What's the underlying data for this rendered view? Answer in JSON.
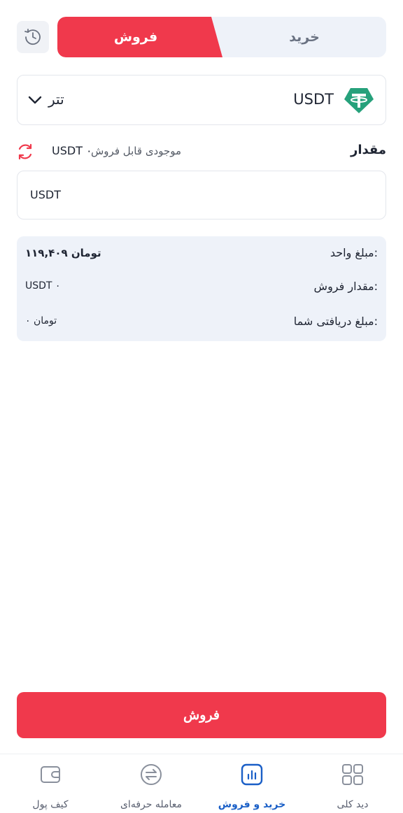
{
  "header": {
    "tabs": [
      {
        "label": "فروش",
        "active": true
      },
      {
        "label": "خرید",
        "active": false
      }
    ],
    "history_icon": "clock-history-icon"
  },
  "currency": {
    "code": "USDT",
    "name": "تتر",
    "icon": "tether-icon",
    "icon_color": "#26a17b"
  },
  "amount": {
    "label": "مقدار",
    "available_label": "موجودی قابل فروش",
    "available_value": "USDT ۰",
    "unit": "USDT",
    "value": ""
  },
  "summary": {
    "rows": [
      {
        "label": "مبلغ واحد:",
        "value": "۱۱۹,۴۰۹ تومان"
      },
      {
        "label": "مقدار فروش:",
        "value": "USDT ۰"
      },
      {
        "label": "مبلغ دریافتی شما:",
        "value": "۰ تومان"
      }
    ]
  },
  "action": {
    "sell_label": "فروش"
  },
  "nav": {
    "items": [
      {
        "label": "کیف پول",
        "icon": "wallet-icon",
        "active": false
      },
      {
        "label": "معامله حرفه‌ای",
        "icon": "exchange-icon",
        "active": false
      },
      {
        "label": "خرید و فروش",
        "icon": "chart-bars-icon",
        "active": true
      },
      {
        "label": "دید کلی",
        "icon": "grid-icon",
        "active": false
      }
    ]
  },
  "colors": {
    "accent_red": "#f0394c",
    "accent_blue": "#1a5fc7",
    "panel_bg": "#eef2f9"
  }
}
